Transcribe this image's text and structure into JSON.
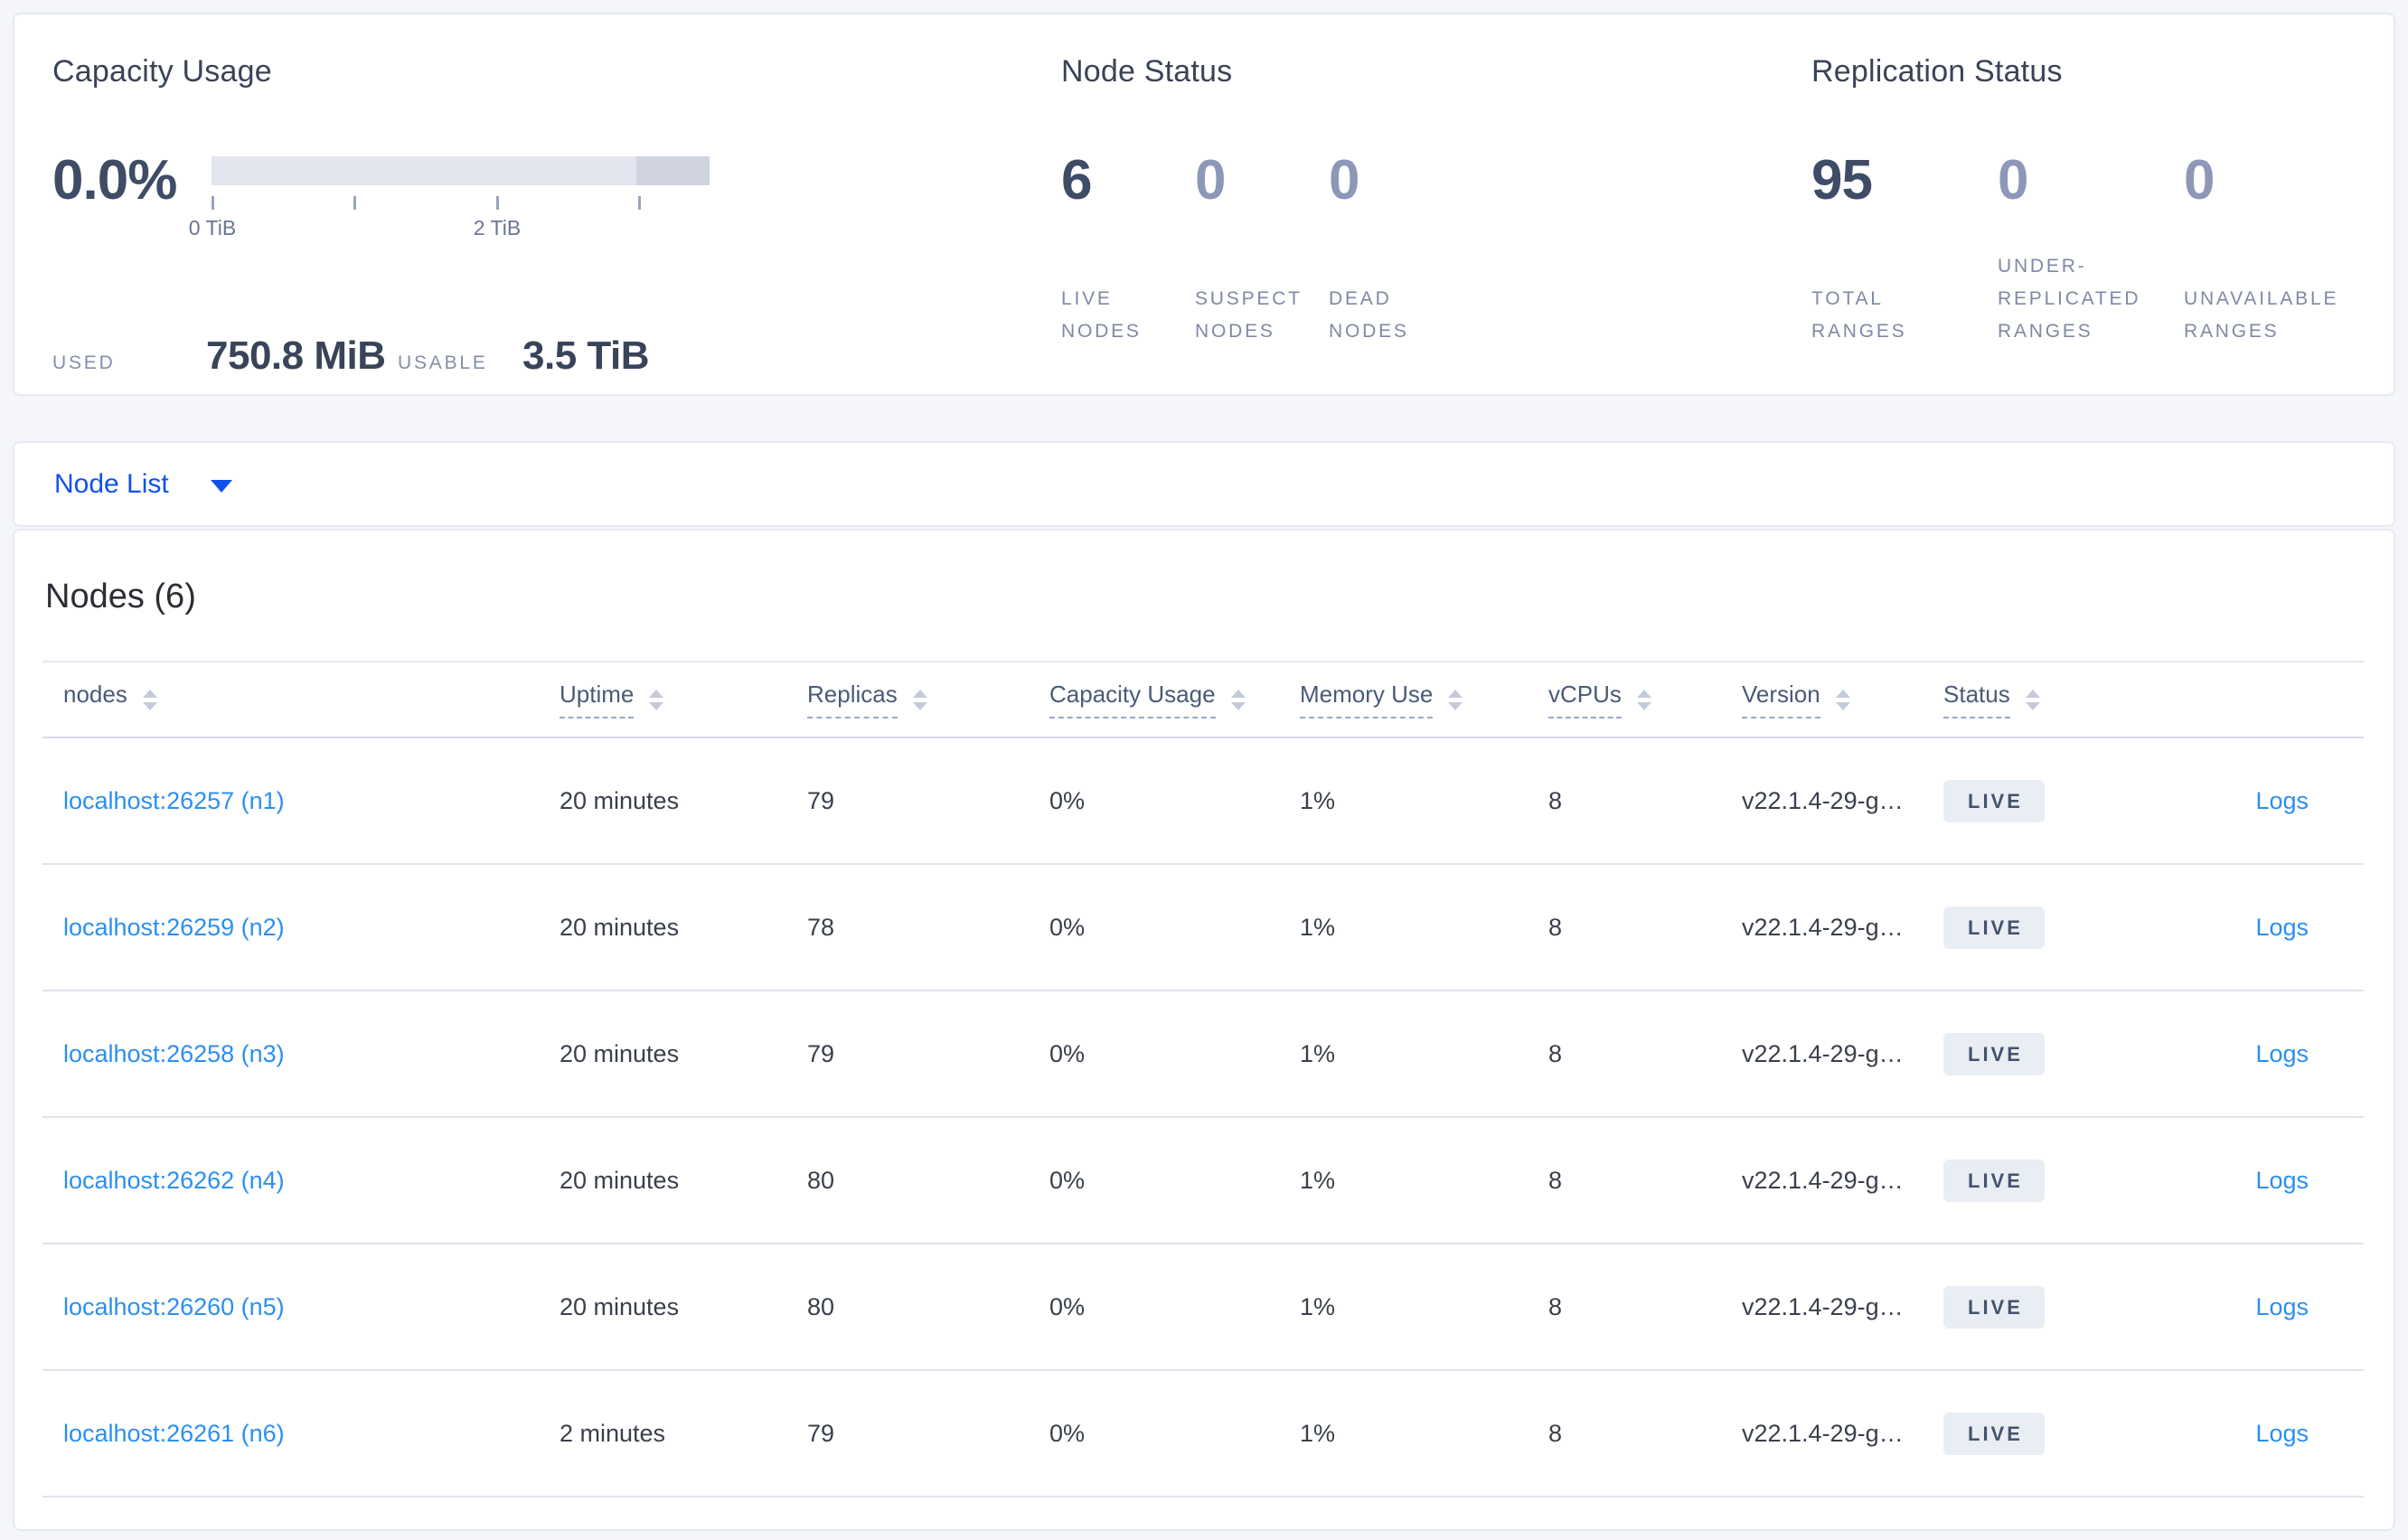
{
  "summary": {
    "capacity": {
      "title": "Capacity Usage",
      "percent": "0.0%",
      "tick_labels": {
        "start": "0 TiB",
        "mid": "2 TiB"
      },
      "used_label": "USED",
      "used_value": "750.8 MiB",
      "usable_label": "USABLE",
      "usable_value": "3.5 TiB"
    },
    "node_status": {
      "title": "Node Status",
      "stats": [
        {
          "value": "6",
          "label": "LIVE NODES"
        },
        {
          "value": "0",
          "label": "SUSPECT NODES"
        },
        {
          "value": "0",
          "label": "DEAD NODES"
        }
      ]
    },
    "replication": {
      "title": "Replication Status",
      "stats": [
        {
          "value": "95",
          "label": "TOTAL RANGES"
        },
        {
          "value": "0",
          "label": "UNDER-REPLICATED RANGES"
        },
        {
          "value": "0",
          "label": "UNAVAILABLE RANGES"
        }
      ]
    }
  },
  "view_selector": {
    "label": "Node List"
  },
  "table": {
    "title": "Nodes (6)",
    "columns": [
      "nodes",
      "Uptime",
      "Replicas",
      "Capacity Usage",
      "Memory Use",
      "vCPUs",
      "Version",
      "Status"
    ],
    "rows": [
      {
        "node": "localhost:26257 (n1)",
        "uptime": "20 minutes",
        "replicas": "79",
        "capacity": "0%",
        "memory": "1%",
        "vcpus": "8",
        "version": "v22.1.4-29-g…",
        "status": "LIVE",
        "logs": "Logs"
      },
      {
        "node": "localhost:26259 (n2)",
        "uptime": "20 minutes",
        "replicas": "78",
        "capacity": "0%",
        "memory": "1%",
        "vcpus": "8",
        "version": "v22.1.4-29-g…",
        "status": "LIVE",
        "logs": "Logs"
      },
      {
        "node": "localhost:26258 (n3)",
        "uptime": "20 minutes",
        "replicas": "79",
        "capacity": "0%",
        "memory": "1%",
        "vcpus": "8",
        "version": "v22.1.4-29-g…",
        "status": "LIVE",
        "logs": "Logs"
      },
      {
        "node": "localhost:26262 (n4)",
        "uptime": "20 minutes",
        "replicas": "80",
        "capacity": "0%",
        "memory": "1%",
        "vcpus": "8",
        "version": "v22.1.4-29-g…",
        "status": "LIVE",
        "logs": "Logs"
      },
      {
        "node": "localhost:26260 (n5)",
        "uptime": "20 minutes",
        "replicas": "80",
        "capacity": "0%",
        "memory": "1%",
        "vcpus": "8",
        "version": "v22.1.4-29-g…",
        "status": "LIVE",
        "logs": "Logs"
      },
      {
        "node": "localhost:26261 (n6)",
        "uptime": "2 minutes",
        "replicas": "79",
        "capacity": "0%",
        "memory": "1%",
        "vcpus": "8",
        "version": "v22.1.4-29-g…",
        "status": "LIVE",
        "logs": "Logs"
      }
    ]
  },
  "icons": {
    "view_selector_caret": "caret-down-icon",
    "column_sort": "sort-icon"
  },
  "colors": {
    "page_bg": "#f4f6fa",
    "card_border": "#e6eaf0",
    "accent_blue": "#1150ef",
    "link_blue": "#2b8ff2",
    "title_slate": "#3a4457",
    "number_dark": "#3e4c66",
    "number_light": "#8d97b8",
    "label_gray": "#7f89a6",
    "badge_bg": "#e9edf4",
    "badge_text": "#44536d",
    "bar_light": "#e3e6ee",
    "bar_dark": "#cfd4e0"
  }
}
